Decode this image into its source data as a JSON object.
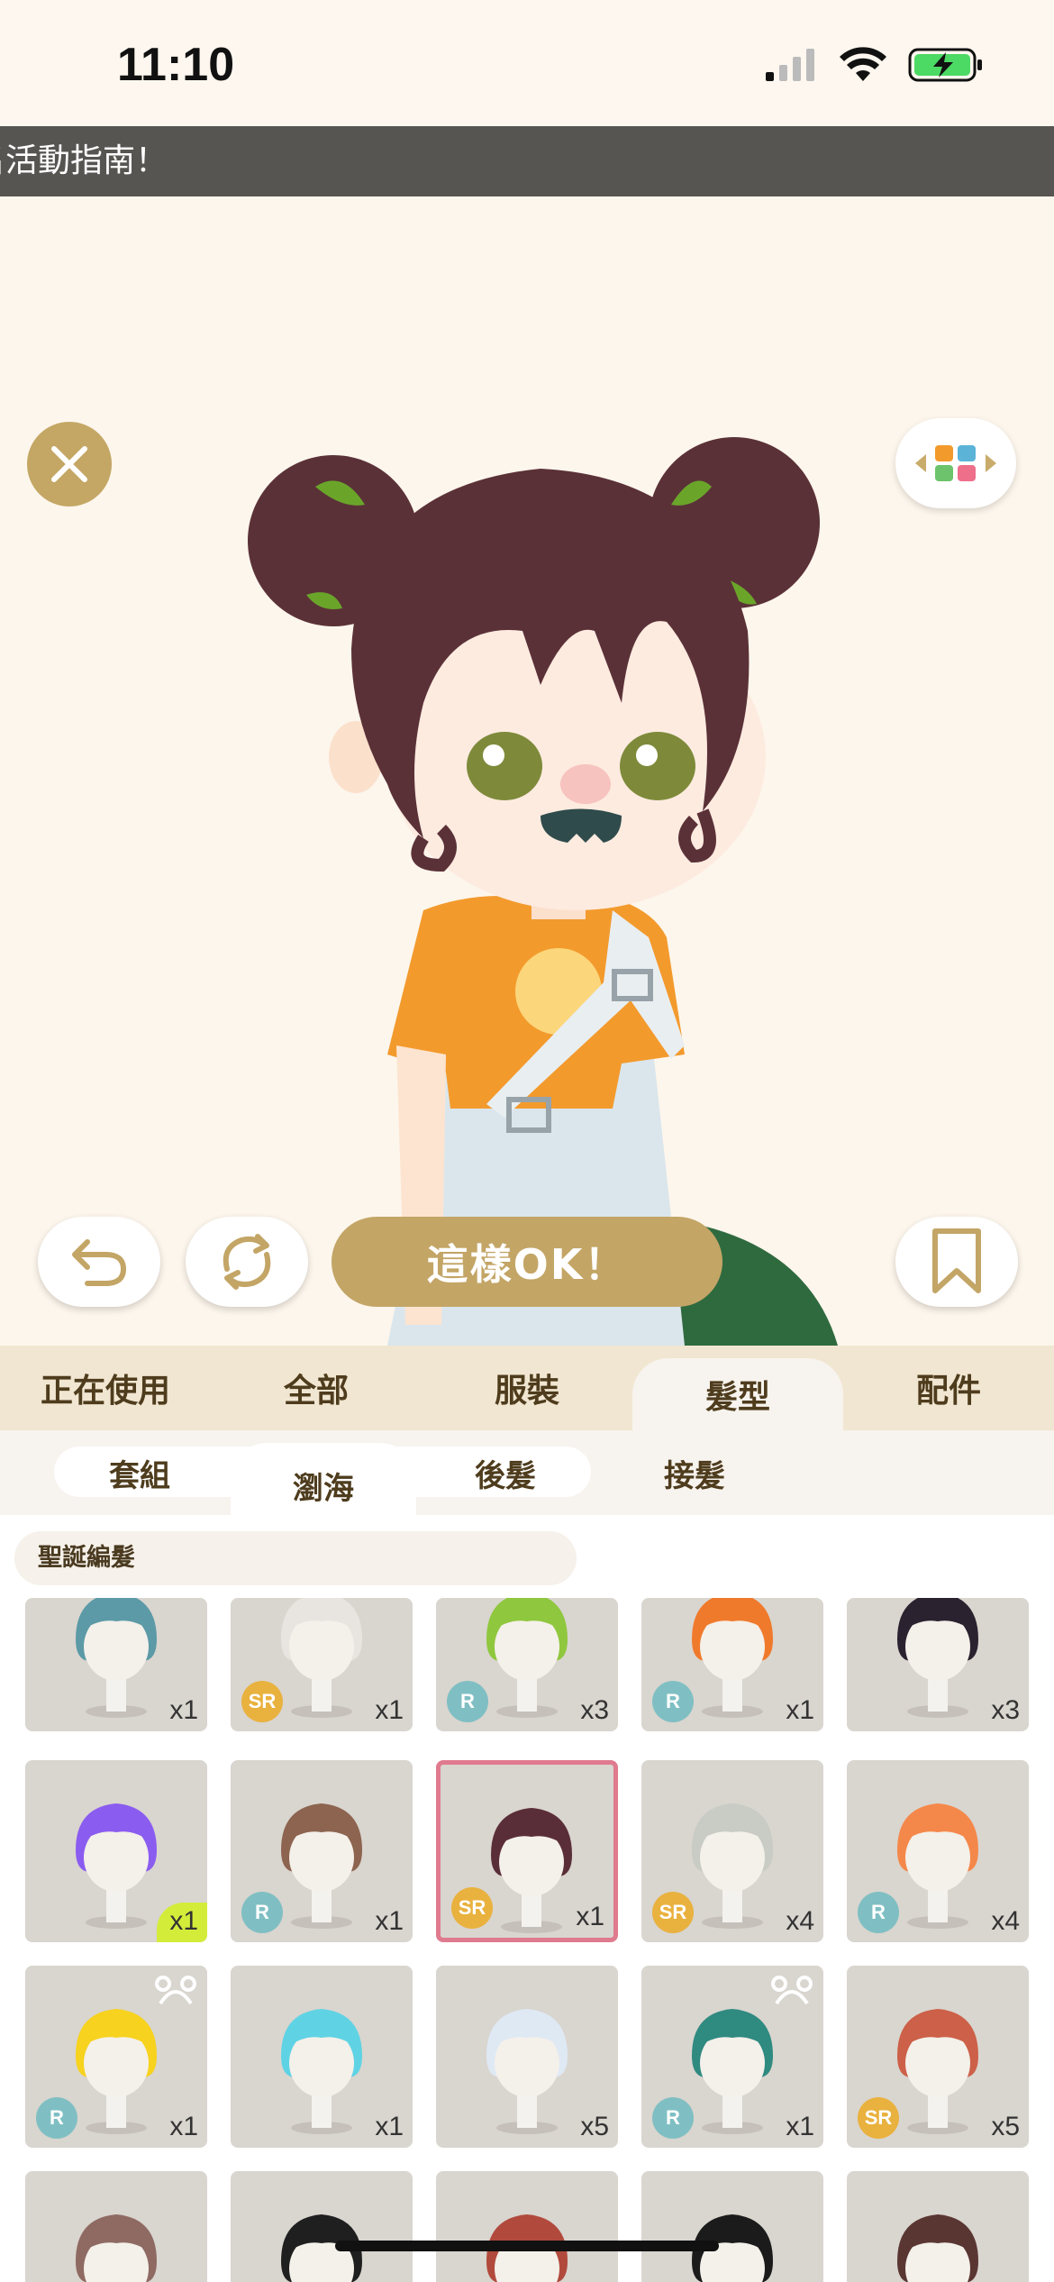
{
  "status_bar": {
    "time": "11:10"
  },
  "ticker": {
    "text": "名活動指南！"
  },
  "stage": {
    "confirm_label": "這樣OK！"
  },
  "main_tabs": [
    {
      "label": "正在使用",
      "active": false
    },
    {
      "label": "全部",
      "active": false
    },
    {
      "label": "服裝",
      "active": false
    },
    {
      "label": "髮型",
      "active": true
    },
    {
      "label": "配件",
      "active": false
    }
  ],
  "sub_tabs": [
    {
      "label": "套組",
      "active": false
    },
    {
      "label": "瀏海",
      "active": true
    },
    {
      "label": "後髮",
      "active": false
    },
    {
      "label": "接髮",
      "active": false
    }
  ],
  "filter": {
    "label": "聖誕編髮"
  },
  "items": [
    {
      "hair": "#5b9aa6",
      "rarity": "",
      "qty": "x1"
    },
    {
      "hair": "#e8e4e0",
      "rarity": "SR",
      "qty": "x1"
    },
    {
      "hair": "#8fc73e",
      "rarity": "R",
      "qty": "x3"
    },
    {
      "hair": "#f07a2c",
      "rarity": "R",
      "qty": "x1"
    },
    {
      "hair": "#2b2230",
      "rarity": "",
      "qty": "x3"
    },
    {
      "hair": "#8b5cf0",
      "rarity": "",
      "qty": "x1",
      "new": true
    },
    {
      "hair": "#8c6450",
      "rarity": "R",
      "qty": "x1"
    },
    {
      "hair": "#5a2e38",
      "rarity": "SR",
      "qty": "x1",
      "selected": true
    },
    {
      "hair": "#c9cbc5",
      "rarity": "SR",
      "qty": "x4"
    },
    {
      "hair": "#f4884a",
      "rarity": "R",
      "qty": "x4"
    },
    {
      "hair": "#f7d21e",
      "rarity": "R",
      "qty": "x1",
      "bear": true
    },
    {
      "hair": "#5fd3e4",
      "rarity": "",
      "qty": "x1"
    },
    {
      "hair": "#dfe9f4",
      "rarity": "",
      "qty": "x5"
    },
    {
      "hair": "#2f8a80",
      "rarity": "R",
      "qty": "x1",
      "bear": true
    },
    {
      "hair": "#cc6048",
      "rarity": "SR",
      "qty": "x5"
    },
    {
      "hair": "#8e6a62",
      "rarity": "",
      "qty": ""
    },
    {
      "hair": "#1f1f1f",
      "rarity": "",
      "qty": ""
    },
    {
      "hair": "#b14a3c",
      "rarity": "",
      "qty": ""
    },
    {
      "hair": "#1b1b1b",
      "rarity": "",
      "qty": ""
    },
    {
      "hair": "#5a3632",
      "rarity": "",
      "qty": ""
    }
  ],
  "icons": {
    "close": "close-icon",
    "grid": "layout-grid-icon",
    "undo": "undo-icon",
    "random": "shuffle-icon",
    "bookmark": "bookmark-icon"
  },
  "colors": {
    "accent": "#c3a566",
    "selected_border": "#e07a8e",
    "tab_bar": "#f1e6d1"
  }
}
